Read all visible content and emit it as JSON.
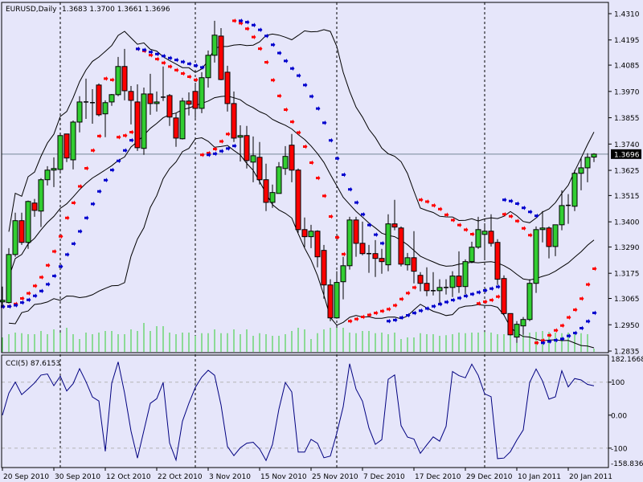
{
  "header": {
    "symbol_label": "EURUSD,Daily",
    "ohlc_label": "1.3683 1.3700 1.3661 1.3696"
  },
  "cci_panel": {
    "label": "CCI(5) 87.6153",
    "axis_labels": [
      "182.1668",
      "100",
      "0.00",
      "-100",
      "-158.836"
    ]
  },
  "current_price": "1.3696",
  "colors": {
    "background": "#e6e6fa",
    "bull": "#32cd32",
    "bear": "#ff0000",
    "sar_fast": "#ff0000",
    "sar_slow": "#0000cd",
    "cci_line": "#000080",
    "volume": "#32cd32",
    "bands": "#000000"
  },
  "chart_data": {
    "type": "candlestick",
    "title": "EURUSD,Daily",
    "price_axis": {
      "range": [
        1.2835,
        1.431
      ],
      "ticks": [
        "1.4310",
        "1.4195",
        "1.4085",
        "1.3970",
        "1.3855",
        "1.3740",
        "1.3625",
        "1.3515",
        "1.3400",
        "1.3290",
        "1.3175",
        "1.3065",
        "1.2950",
        "1.2835"
      ]
    },
    "cci_axis": {
      "range": [
        -158.836,
        182.1668
      ],
      "levels": [
        100,
        0,
        -100
      ]
    },
    "x_labels": [
      {
        "index": 0,
        "text": "20 Sep 2010"
      },
      {
        "index": 8,
        "text": "30 Sep 2010"
      },
      {
        "index": 16,
        "text": "12 Oct 2010"
      },
      {
        "index": 24,
        "text": "22 Oct 2010"
      },
      {
        "index": 32,
        "text": "3 Nov 2010"
      },
      {
        "index": 40,
        "text": "15 Nov 2010"
      },
      {
        "index": 48,
        "text": "25 Nov 2010"
      },
      {
        "index": 56,
        "text": "7 Dec 2010"
      },
      {
        "index": 64,
        "text": "17 Dec 2010"
      },
      {
        "index": 72,
        "text": "29 Dec 2010"
      },
      {
        "index": 80,
        "text": "10 Jan 2011"
      },
      {
        "index": 88,
        "text": "20 Jan 2011"
      }
    ],
    "period_separators": [
      9,
      30,
      52,
      75
    ],
    "ohlc": [
      [
        1.305,
        1.3117,
        1.3029,
        1.3057
      ],
      [
        1.3047,
        1.3285,
        1.3043,
        1.3257
      ],
      [
        1.3257,
        1.344,
        1.3247,
        1.3405
      ],
      [
        1.3405,
        1.344,
        1.3299,
        1.331
      ],
      [
        1.331,
        1.3493,
        1.3282,
        1.3489
      ],
      [
        1.3482,
        1.35,
        1.3422,
        1.345
      ],
      [
        1.3447,
        1.3591,
        1.3377,
        1.3584
      ],
      [
        1.3584,
        1.3643,
        1.3559,
        1.3626
      ],
      [
        1.3626,
        1.3682,
        1.3552,
        1.3633
      ],
      [
        1.3629,
        1.3784,
        1.3622,
        1.3777
      ],
      [
        1.3784,
        1.3784,
        1.3661,
        1.3679
      ],
      [
        1.3671,
        1.3843,
        1.3629,
        1.3836
      ],
      [
        1.3836,
        1.3949,
        1.3791,
        1.3924
      ],
      [
        1.3924,
        1.4026,
        1.385,
        1.3924
      ],
      [
        1.3921,
        1.398,
        1.3829,
        1.392
      ],
      [
        1.3998,
        1.4005,
        1.3861,
        1.3868
      ],
      [
        1.3872,
        1.3931,
        1.377,
        1.3921
      ],
      [
        1.3924,
        1.3959,
        1.3907,
        1.3956
      ],
      [
        1.3956,
        1.4121,
        1.3949,
        1.4079
      ],
      [
        1.4079,
        1.4156,
        1.3931,
        1.3973
      ],
      [
        1.397,
        1.3994,
        1.3826,
        1.3931
      ],
      [
        1.3924,
        1.4001,
        1.371,
        1.3724
      ],
      [
        1.3721,
        1.3987,
        1.3693,
        1.3959
      ],
      [
        1.3959,
        1.4047,
        1.3868,
        1.3917
      ],
      [
        1.3917,
        1.397,
        1.3882,
        1.3924
      ],
      [
        1.3945,
        1.4079,
        1.3928,
        1.3945
      ],
      [
        1.3952,
        1.3959,
        1.3819,
        1.3858
      ],
      [
        1.3854,
        1.3875,
        1.3728,
        1.3766
      ],
      [
        1.3763,
        1.3942,
        1.376,
        1.3928
      ],
      [
        1.3928,
        1.3966,
        1.3865,
        1.3914
      ],
      [
        1.397,
        1.4008,
        1.3854,
        1.3896
      ],
      [
        1.3896,
        1.4054,
        1.3875,
        1.403
      ],
      [
        1.403,
        1.4149,
        1.3987,
        1.4128
      ],
      [
        1.4128,
        1.4279,
        1.4096,
        1.4216
      ],
      [
        1.4212,
        1.4247,
        1.4019,
        1.4022
      ],
      [
        1.4054,
        1.4082,
        1.3882,
        1.3917
      ],
      [
        1.3917,
        1.397,
        1.3749,
        1.3766
      ],
      [
        1.377,
        1.3822,
        1.3664,
        1.3777
      ],
      [
        1.3777,
        1.3819,
        1.3633,
        1.3668
      ],
      [
        1.3661,
        1.3773,
        1.3573,
        1.3689
      ],
      [
        1.3682,
        1.3749,
        1.3563,
        1.3584
      ],
      [
        1.3584,
        1.3654,
        1.3447,
        1.3485
      ],
      [
        1.3485,
        1.3563,
        1.3461,
        1.3528
      ],
      [
        1.3524,
        1.3661,
        1.3524,
        1.364
      ],
      [
        1.3633,
        1.3731,
        1.3605,
        1.3686
      ],
      [
        1.3735,
        1.3784,
        1.3573,
        1.3626
      ],
      [
        1.3626,
        1.3633,
        1.3352,
        1.3366
      ],
      [
        1.3366,
        1.3419,
        1.3289,
        1.3335
      ],
      [
        1.3335,
        1.3387,
        1.3285,
        1.3359
      ],
      [
        1.3359,
        1.3363,
        1.3201,
        1.3247
      ],
      [
        1.3275,
        1.3299,
        1.3064,
        1.3124
      ],
      [
        1.3124,
        1.3149,
        1.2966,
        1.298
      ],
      [
        1.298,
        1.3184,
        1.2977,
        1.3135
      ],
      [
        1.3138,
        1.3247,
        1.3061,
        1.3208
      ],
      [
        1.3208,
        1.3422,
        1.3191,
        1.3408
      ],
      [
        1.3408,
        1.3422,
        1.3247,
        1.3306
      ],
      [
        1.3306,
        1.3401,
        1.3254,
        1.3261
      ],
      [
        1.3261,
        1.3299,
        1.3177,
        1.3261
      ],
      [
        1.3261,
        1.332,
        1.3159,
        1.324
      ],
      [
        1.324,
        1.3282,
        1.3173,
        1.3226
      ],
      [
        1.3212,
        1.3433,
        1.3184,
        1.3391
      ],
      [
        1.3391,
        1.3496,
        1.3363,
        1.3377
      ],
      [
        1.3373,
        1.338,
        1.3205,
        1.3215
      ],
      [
        1.3212,
        1.3264,
        1.3187,
        1.3243
      ],
      [
        1.3243,
        1.3359,
        1.3131,
        1.3184
      ],
      [
        1.3166,
        1.318,
        1.3096,
        1.3131
      ],
      [
        1.3131,
        1.3201,
        1.3075,
        1.3099
      ],
      [
        1.3099,
        1.318,
        1.3078,
        1.3099
      ],
      [
        1.3099,
        1.3149,
        1.3043,
        1.3113
      ],
      [
        1.3113,
        1.3149,
        1.3082,
        1.3113
      ],
      [
        1.3113,
        1.3184,
        1.3071,
        1.3163
      ],
      [
        1.3163,
        1.3271,
        1.3089,
        1.3117
      ],
      [
        1.3117,
        1.3236,
        1.3082,
        1.3226
      ],
      [
        1.3226,
        1.3313,
        1.3219,
        1.3289
      ],
      [
        1.3289,
        1.3422,
        1.3282,
        1.3366
      ],
      [
        1.3345,
        1.3394,
        1.3236,
        1.3359
      ],
      [
        1.3359,
        1.3433,
        1.3292,
        1.3306
      ],
      [
        1.331,
        1.3324,
        1.3124,
        1.3149
      ],
      [
        1.3152,
        1.3166,
        1.2994,
        1.2999
      ],
      [
        1.2999,
        1.2999,
        1.2903,
        1.2906
      ],
      [
        1.2896,
        1.2966,
        1.2871,
        1.2952
      ],
      [
        1.2945,
        1.2984,
        1.2906,
        1.2973
      ],
      [
        1.2973,
        1.3149,
        1.2966,
        1.3131
      ],
      [
        1.3131,
        1.338,
        1.3089,
        1.3366
      ],
      [
        1.3366,
        1.3447,
        1.331,
        1.3373
      ],
      [
        1.3373,
        1.338,
        1.324,
        1.3292
      ],
      [
        1.3292,
        1.3387,
        1.325,
        1.3387
      ],
      [
        1.3387,
        1.3538,
        1.3363,
        1.3471
      ],
      [
        1.3471,
        1.3521,
        1.3391,
        1.3472
      ],
      [
        1.3468,
        1.3626,
        1.3447,
        1.3612
      ],
      [
        1.3612,
        1.3682,
        1.3538,
        1.3636
      ],
      [
        1.3636,
        1.37,
        1.3573,
        1.3682
      ],
      [
        1.3683,
        1.37,
        1.3661,
        1.3696
      ]
    ],
    "volume_relative": [
      45,
      55,
      60,
      58,
      55,
      55,
      65,
      55,
      70,
      60,
      75,
      55,
      40,
      60,
      55,
      60,
      65,
      65,
      55,
      55,
      70,
      65,
      90,
      65,
      80,
      80,
      60,
      55,
      60,
      60,
      50,
      58,
      58,
      70,
      58,
      58,
      70,
      55,
      70,
      50,
      58,
      55,
      50,
      50,
      55,
      65,
      75,
      70,
      40,
      58,
      70,
      75,
      75,
      75,
      60,
      58,
      65,
      65,
      58,
      60,
      55,
      60,
      40,
      45,
      45,
      58,
      55,
      55,
      50,
      52,
      55,
      60,
      58,
      60,
      60,
      62,
      60,
      55,
      55,
      58,
      50,
      55,
      60,
      62,
      65,
      62,
      60,
      58,
      60,
      62,
      58,
      55,
      10
    ]
  }
}
